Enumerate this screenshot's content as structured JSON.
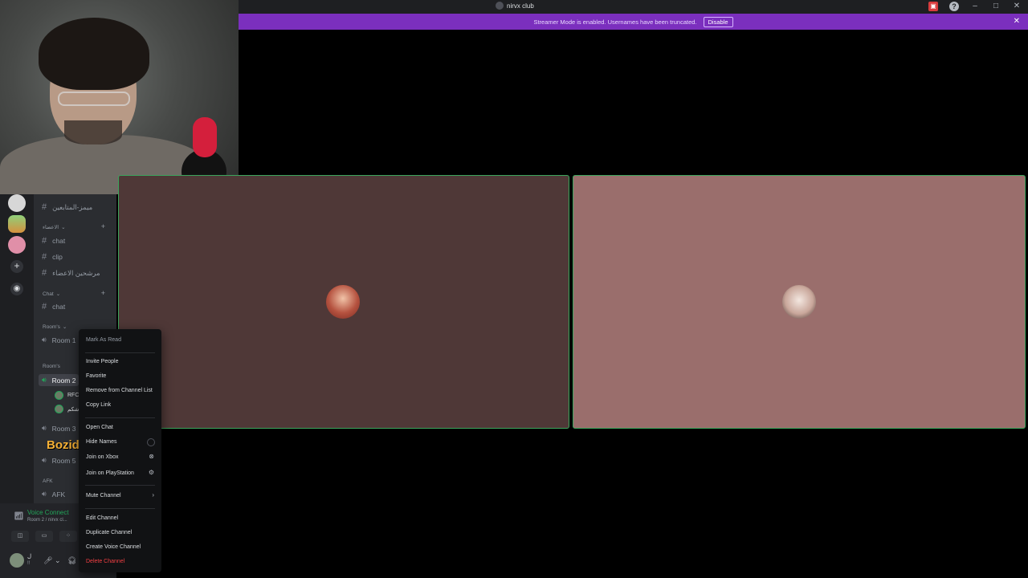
{
  "titlebar": {
    "app_name": "nirvx club",
    "icons": [
      "inbox-icon",
      "help-icon",
      "minimize-icon",
      "maximize-icon",
      "close-icon"
    ]
  },
  "banner": {
    "message": "Streamer Mode is enabled. Usernames have been truncated.",
    "disable_label": "Disable",
    "close": "✕"
  },
  "servers": [
    "server-1",
    "server-2",
    "server-3"
  ],
  "channels": {
    "top_channel": "ميمز-المتابعين",
    "cat1": "الاعضاء",
    "chat1": "chat",
    "clip": "clip",
    "feedback": "مرشحين الاعضاء",
    "cat2": "Chat",
    "chat2": "chat",
    "cat3": "Room's",
    "room1": "Room 1",
    "cat4": "Room's",
    "room2": "Room 2",
    "member1": "RFC",
    "member2": "ابو شكم",
    "room3": "Room 3",
    "room5": "Room 5",
    "cat5": "AFK",
    "afk": "AFK",
    "overlay_name": "Bozidd"
  },
  "voice": {
    "status": "Voice Connect",
    "sub": "Room 2 / nirvx cl..."
  },
  "user": {
    "name": "ل",
    "tag": "!!"
  },
  "menu": {
    "mark_read": "Mark As Read",
    "invite": "Invite People",
    "favorite": "Favorite",
    "remove": "Remove from Channel List",
    "copy_link": "Copy Link",
    "open_chat": "Open Chat",
    "hide_names": "Hide Names",
    "join_xbox": "Join on Xbox",
    "join_ps": "Join on PlayStation",
    "mute": "Mute Channel",
    "edit": "Edit Channel",
    "duplicate": "Duplicate Channel",
    "create_voice": "Create Voice Channel",
    "delete": "Delete Channel"
  },
  "colors": {
    "accent_banner": "#7b2fbe",
    "speaking_border": "#3ba55c",
    "danger": "#f23f43"
  }
}
